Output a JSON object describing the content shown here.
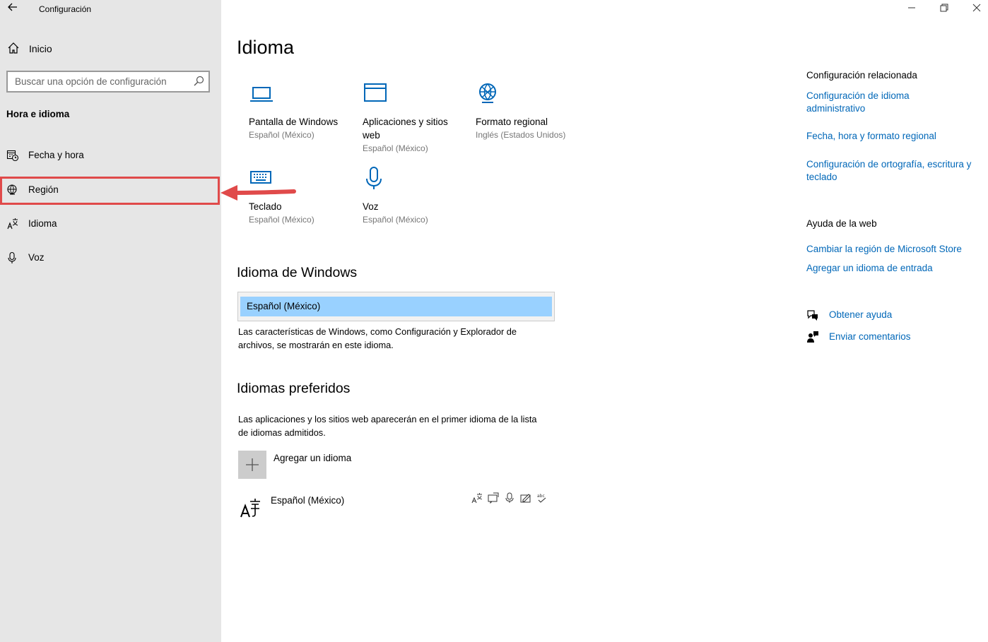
{
  "window": {
    "title": "Configuración",
    "back_icon": "arrow-left-icon",
    "controls": {
      "minimize": "—",
      "restore": "❐",
      "close": "✕"
    }
  },
  "sidebar": {
    "home_label": "Inicio",
    "search_placeholder": "Buscar una opción de configuración",
    "section_title": "Hora e idioma",
    "items": [
      {
        "label": "Fecha y hora",
        "icon": "clock-calendar-icon"
      },
      {
        "label": "Región",
        "icon": "globe-icon",
        "selected": true
      },
      {
        "label": "Idioma",
        "icon": "language-icon"
      },
      {
        "label": "Voz",
        "icon": "microphone-icon"
      }
    ]
  },
  "main": {
    "title": "Idioma",
    "tiles": [
      {
        "name": "Pantalla de Windows",
        "sub": "Español (México)",
        "icon": "laptop-icon"
      },
      {
        "name": "Aplicaciones y sitios web",
        "sub": "Español (México)",
        "icon": "browser-window-icon"
      },
      {
        "name": "Formato regional",
        "sub": "Inglés (Estados Unidos)",
        "icon": "globe-icon"
      },
      {
        "name": "Teclado",
        "sub": "Español (México)",
        "icon": "keyboard-icon"
      },
      {
        "name": "Voz",
        "sub": "Español (México)",
        "icon": "microphone-icon"
      }
    ],
    "windows_language": {
      "heading": "Idioma de Windows",
      "selected": "Español (México)",
      "description": "Las características de Windows, como Configuración y Explorador de archivos, se mostrarán en este idioma."
    },
    "preferred": {
      "heading": "Idiomas preferidos",
      "description": "Las aplicaciones y los sitios web aparecerán en el primer idioma de la lista de idiomas admitidos.",
      "add_label": "Agregar un idioma",
      "languages": [
        {
          "label": "Español (México)",
          "feature_icons": [
            "language-icon",
            "speech-icon",
            "microphone-icon",
            "handwriting-icon",
            "spellcheck-icon"
          ]
        }
      ]
    }
  },
  "right": {
    "related_heading": "Configuración relacionada",
    "related_links": [
      "Configuración de idioma administrativo",
      "Fecha, hora y formato regional",
      "Configuración de ortografía, escritura y teclado"
    ],
    "web_help_heading": "Ayuda de la web",
    "web_links": [
      "Cambiar la región de Microsoft Store",
      "Agregar un idioma de entrada"
    ],
    "help": {
      "get_help": "Obtener ayuda",
      "feedback": "Enviar comentarios"
    }
  },
  "colors": {
    "accent": "#0067b8",
    "sidebar_bg": "#e6e6e6",
    "selection": "#99d1ff",
    "annotation": "#e04a4a"
  }
}
